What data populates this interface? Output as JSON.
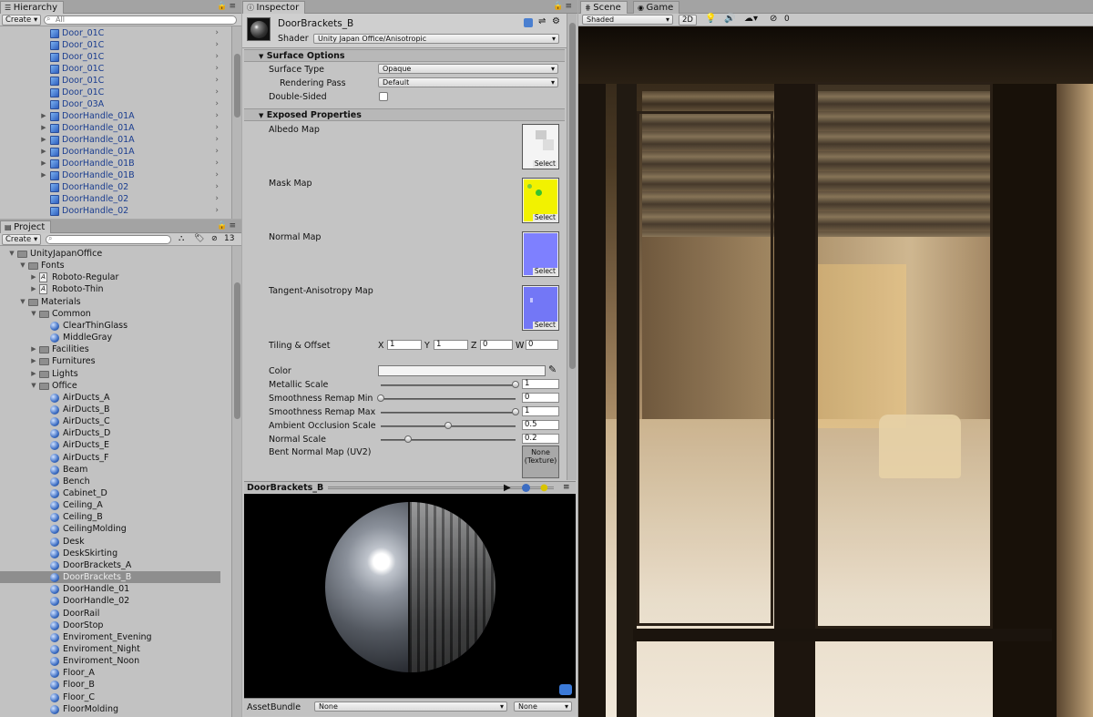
{
  "hierarchy": {
    "tab": "Hierarchy",
    "create": "Create",
    "search_placeholder": "All",
    "items": [
      {
        "label": "Door_01C",
        "expand": false
      },
      {
        "label": "Door_01C",
        "expand": false
      },
      {
        "label": "Door_01C",
        "expand": false
      },
      {
        "label": "Door_01C",
        "expand": false
      },
      {
        "label": "Door_01C",
        "expand": false
      },
      {
        "label": "Door_01C",
        "expand": false
      },
      {
        "label": "Door_03A",
        "expand": false
      },
      {
        "label": "DoorHandle_01A",
        "expand": true
      },
      {
        "label": "DoorHandle_01A",
        "expand": true
      },
      {
        "label": "DoorHandle_01A",
        "expand": true
      },
      {
        "label": "DoorHandle_01A",
        "expand": true
      },
      {
        "label": "DoorHandle_01B",
        "expand": true
      },
      {
        "label": "DoorHandle_01B",
        "expand": true
      },
      {
        "label": "DoorHandle_02",
        "expand": false
      },
      {
        "label": "DoorHandle_02",
        "expand": false
      },
      {
        "label": "DoorHandle_02",
        "expand": false
      }
    ]
  },
  "project": {
    "tab": "Project",
    "create": "Create",
    "count": "13",
    "tree": [
      {
        "label": "UnityJapanOffice",
        "type": "folder",
        "depth": 0,
        "arrow": "▼"
      },
      {
        "label": "Fonts",
        "type": "folder",
        "depth": 1,
        "arrow": "▼"
      },
      {
        "label": "Roboto-Regular",
        "type": "font",
        "depth": 2,
        "arrow": "▶"
      },
      {
        "label": "Roboto-Thin",
        "type": "font",
        "depth": 2,
        "arrow": "▶"
      },
      {
        "label": "Materials",
        "type": "folder",
        "depth": 1,
        "arrow": "▼"
      },
      {
        "label": "Common",
        "type": "folder",
        "depth": 2,
        "arrow": "▼"
      },
      {
        "label": "ClearThinGlass",
        "type": "material",
        "depth": 3,
        "arrow": ""
      },
      {
        "label": "MiddleGray",
        "type": "material",
        "depth": 3,
        "arrow": ""
      },
      {
        "label": "Facilities",
        "type": "folder",
        "depth": 2,
        "arrow": "▶"
      },
      {
        "label": "Furnitures",
        "type": "folder",
        "depth": 2,
        "arrow": "▶"
      },
      {
        "label": "Lights",
        "type": "folder",
        "depth": 2,
        "arrow": "▶"
      },
      {
        "label": "Office",
        "type": "folder",
        "depth": 2,
        "arrow": "▼"
      },
      {
        "label": "AirDucts_A",
        "type": "material",
        "depth": 3,
        "arrow": ""
      },
      {
        "label": "AirDucts_B",
        "type": "material",
        "depth": 3,
        "arrow": ""
      },
      {
        "label": "AirDucts_C",
        "type": "material",
        "depth": 3,
        "arrow": ""
      },
      {
        "label": "AirDucts_D",
        "type": "material",
        "depth": 3,
        "arrow": ""
      },
      {
        "label": "AirDucts_E",
        "type": "material",
        "depth": 3,
        "arrow": ""
      },
      {
        "label": "AirDucts_F",
        "type": "material",
        "depth": 3,
        "arrow": ""
      },
      {
        "label": "Beam",
        "type": "material",
        "depth": 3,
        "arrow": ""
      },
      {
        "label": "Bench",
        "type": "material",
        "depth": 3,
        "arrow": ""
      },
      {
        "label": "Cabinet_D",
        "type": "material",
        "depth": 3,
        "arrow": ""
      },
      {
        "label": "Ceiling_A",
        "type": "material",
        "depth": 3,
        "arrow": ""
      },
      {
        "label": "Ceiling_B",
        "type": "material",
        "depth": 3,
        "arrow": ""
      },
      {
        "label": "CeilingMolding",
        "type": "material",
        "depth": 3,
        "arrow": ""
      },
      {
        "label": "Desk",
        "type": "material",
        "depth": 3,
        "arrow": ""
      },
      {
        "label": "DeskSkirting",
        "type": "material",
        "depth": 3,
        "arrow": ""
      },
      {
        "label": "DoorBrackets_A",
        "type": "material",
        "depth": 3,
        "arrow": ""
      },
      {
        "label": "DoorBrackets_B",
        "type": "material",
        "depth": 3,
        "arrow": "",
        "selected": true
      },
      {
        "label": "DoorHandle_01",
        "type": "material",
        "depth": 3,
        "arrow": ""
      },
      {
        "label": "DoorHandle_02",
        "type": "material",
        "depth": 3,
        "arrow": ""
      },
      {
        "label": "DoorRail",
        "type": "material",
        "depth": 3,
        "arrow": ""
      },
      {
        "label": "DoorStop",
        "type": "material",
        "depth": 3,
        "arrow": ""
      },
      {
        "label": "Enviroment_Evening",
        "type": "material",
        "depth": 3,
        "arrow": ""
      },
      {
        "label": "Enviroment_Night",
        "type": "material",
        "depth": 3,
        "arrow": ""
      },
      {
        "label": "Enviroment_Noon",
        "type": "material",
        "depth": 3,
        "arrow": ""
      },
      {
        "label": "Floor_A",
        "type": "material",
        "depth": 3,
        "arrow": ""
      },
      {
        "label": "Floor_B",
        "type": "material",
        "depth": 3,
        "arrow": ""
      },
      {
        "label": "Floor_C",
        "type": "material",
        "depth": 3,
        "arrow": ""
      },
      {
        "label": "FloorMolding",
        "type": "material",
        "depth": 3,
        "arrow": ""
      }
    ]
  },
  "inspector": {
    "tab": "Inspector",
    "material_name": "DoorBrackets_B",
    "shader_label": "Shader",
    "shader_value": "Unity Japan Office/Anisotropic",
    "surface_options": {
      "title": "Surface Options",
      "surface_type_label": "Surface Type",
      "surface_type_value": "Opaque",
      "rendering_pass_label": "Rendering Pass",
      "rendering_pass_value": "Default",
      "double_sided_label": "Double-Sided"
    },
    "exposed": {
      "title": "Exposed Properties",
      "albedo": "Albedo Map",
      "mask": "Mask Map",
      "normal": "Normal Map",
      "tangent": "Tangent-Anisotropy Map",
      "select": "Select",
      "tiling_label": "Tiling & Offset",
      "tiling": {
        "X": "1",
        "Y": "1",
        "Z": "0",
        "W": "0"
      },
      "color_label": "Color",
      "sliders": [
        {
          "label": "Metallic Scale",
          "value": "1",
          "level": 1.0
        },
        {
          "label": "Smoothness Remap Min",
          "value": "0",
          "level": 0.0
        },
        {
          "label": "Smoothness Remap Max",
          "value": "1",
          "level": 1.0
        },
        {
          "label": "Ambient Occlusion Scale",
          "value": "0.5",
          "level": 0.5
        },
        {
          "label": "Normal Scale",
          "value": "0.2",
          "level": 0.2
        }
      ],
      "bent_normal_label": "Bent Normal Map (UV2)",
      "bent_normal_value_1": "None",
      "bent_normal_value_2": "(Texture)"
    },
    "preview_title": "DoorBrackets_B",
    "assetbundle_label": "AssetBundle",
    "assetbundle_value": "None",
    "assetbundle_variant": "None"
  },
  "scene": {
    "tab_scene": "Scene",
    "tab_game": "Game",
    "shading_mode": "Shaded",
    "mode_2d": "2D",
    "hidden_count": "0"
  }
}
